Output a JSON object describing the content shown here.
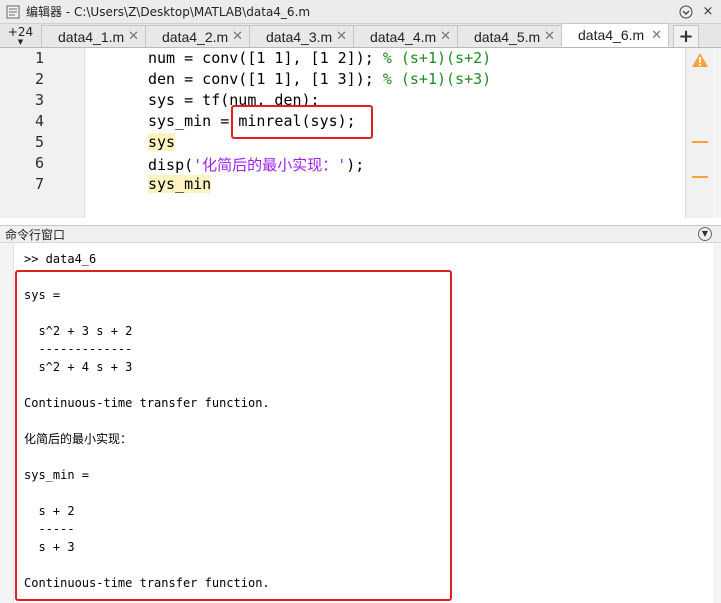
{
  "window": {
    "title": "编辑器 - C:\\Users\\Z\\Desktop\\MATLAB\\data4_6.m",
    "icon": "editor-icon"
  },
  "tabs": {
    "overflow_label": "+24",
    "items": [
      {
        "label": "data4_1.m",
        "active": false
      },
      {
        "label": "data4_2.m",
        "active": false
      },
      {
        "label": "data4_3.m",
        "active": false
      },
      {
        "label": "data4_4.m",
        "active": false
      },
      {
        "label": "data4_5.m",
        "active": false
      },
      {
        "label": "data4_6.m",
        "active": true
      }
    ],
    "add_label": "+"
  },
  "editor": {
    "lines": [
      {
        "num": "1",
        "code": "num = conv([1 1], [1 2]); ",
        "comment": "% (s+1)(s+2)"
      },
      {
        "num": "2",
        "code": "den = conv([1 1], [1 3]); ",
        "comment": "% (s+1)(s+3)"
      },
      {
        "num": "3",
        "code": "sys = tf(num, den);"
      },
      {
        "num": "4",
        "code_pre": "sys_min = ",
        "code": "minreal(sys);"
      },
      {
        "num": "5",
        "code": "sys"
      },
      {
        "num": "6",
        "code_pre": "disp(",
        "string": "'化简后的最小实现：'",
        "code_post": ");"
      },
      {
        "num": "7",
        "code": "sys_min"
      }
    ]
  },
  "command_window": {
    "title": "命令行窗口",
    "prompt_line": ">> data4_6",
    "output": [
      "sys =",
      "  s^2 + 3 s + 2",
      "  -------------",
      "  s^2 + 4 s + 3",
      "Continuous-time transfer function.",
      "化简后的最小实现：",
      "sys_min =",
      "  s + 2",
      "  -----",
      "  s + 3",
      "Continuous-time transfer function."
    ]
  },
  "colors": {
    "highlight_box": "#e0201e",
    "comment": "#228b22",
    "string": "#a020f0",
    "warning": "#f7a23a"
  }
}
